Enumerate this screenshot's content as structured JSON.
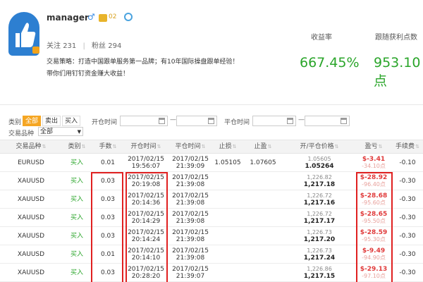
{
  "profile": {
    "username": "manager",
    "gender_icon": "male-icon",
    "level": "02",
    "follow_label": "关注",
    "follow_count": "231",
    "fans_label": "粉丝",
    "fans_count": "294",
    "slogan_label": "交易策略：",
    "slogan_text": "打造中国跟单服务第一品牌；有10年国际操盘跟单经验！带你们用钉钉资金赚大收益！",
    "stats": [
      {
        "label": "收益率",
        "value": "667.45%"
      },
      {
        "label": "跟随获利点数",
        "value": "953.10点"
      }
    ]
  },
  "filter": {
    "category_label": "类别",
    "category_options": [
      "全部",
      "卖出",
      "买入"
    ],
    "category_selected": "全部",
    "open_time_label": "开仓时间",
    "close_time_label": "平仓时间",
    "dash": "—",
    "product_label": "交易品种",
    "product_selected": "全部"
  },
  "table": {
    "headers": [
      "交易品种",
      "类别",
      "手数",
      "开仓时间",
      "平仓时间",
      "止损",
      "止盈",
      "开/平仓价格",
      "盈亏",
      "手续费"
    ],
    "rows": [
      {
        "symbol": "EURUSD",
        "type": "买入",
        "lots": "0.01",
        "open_date": "2017/02/15",
        "open_time": "19:56:07",
        "close_date": "2017/02/15",
        "close_time": "21:39:09",
        "sl": "1.05105",
        "tp": "1.07605",
        "open_price": "1.05605",
        "close_price": "1.05264",
        "profit": "$-3.41",
        "points": "-34.10点",
        "fee": "-0.10"
      },
      {
        "symbol": "XAUUSD",
        "type": "买入",
        "lots": "0.03",
        "open_date": "2017/02/15",
        "open_time": "20:19:08",
        "close_date": "2017/02/15",
        "close_time": "21:39:08",
        "sl": "",
        "tp": "",
        "open_price": "1,226.82",
        "close_price": "1,217.18",
        "profit": "$-28.92",
        "points": "-96.40点",
        "fee": "-0.30"
      },
      {
        "symbol": "XAUUSD",
        "type": "买入",
        "lots": "0.03",
        "open_date": "2017/02/15",
        "open_time": "20:14:36",
        "close_date": "2017/02/15",
        "close_time": "21:39:08",
        "sl": "",
        "tp": "",
        "open_price": "1,226.72",
        "close_price": "1,217.16",
        "profit": "$-28.68",
        "points": "-95.60点",
        "fee": "-0.30"
      },
      {
        "symbol": "XAUUSD",
        "type": "买入",
        "lots": "0.03",
        "open_date": "2017/02/15",
        "open_time": "20:14:29",
        "close_date": "2017/02/15",
        "close_time": "21:39:08",
        "sl": "",
        "tp": "",
        "open_price": "1,226.72",
        "close_price": "1,217.17",
        "profit": "$-28.65",
        "points": "-95.50点",
        "fee": "-0.30"
      },
      {
        "symbol": "XAUUSD",
        "type": "买入",
        "lots": "0.03",
        "open_date": "2017/02/15",
        "open_time": "20:14:24",
        "close_date": "2017/02/15",
        "close_time": "21:39:08",
        "sl": "",
        "tp": "",
        "open_price": "1,226.73",
        "close_price": "1,217.20",
        "profit": "$-28.59",
        "points": "-95.30点",
        "fee": "-0.30"
      },
      {
        "symbol": "XAUUSD",
        "type": "买入",
        "lots": "0.01",
        "open_date": "2017/02/15",
        "open_time": "20:14:10",
        "close_date": "2017/02/15",
        "close_time": "21:39:08",
        "sl": "",
        "tp": "",
        "open_price": "1,226.73",
        "close_price": "1,217.24",
        "profit": "$-9.49",
        "points": "-94.90点",
        "fee": "-0.30"
      },
      {
        "symbol": "XAUUSD",
        "type": "买入",
        "lots": "0.03",
        "open_date": "2017/02/15",
        "open_time": "20:28:20",
        "close_date": "2017/02/15",
        "close_time": "21:39:07",
        "sl": "",
        "tp": "",
        "open_price": "1,226.86",
        "close_price": "1,217.15",
        "profit": "$-29.13",
        "points": "-97.10点",
        "fee": "-0.30"
      }
    ]
  },
  "colors": {
    "accent": "#f5a623",
    "positive": "#2aa52a",
    "loss": "#e03a3a",
    "highlight": "#e02020"
  }
}
